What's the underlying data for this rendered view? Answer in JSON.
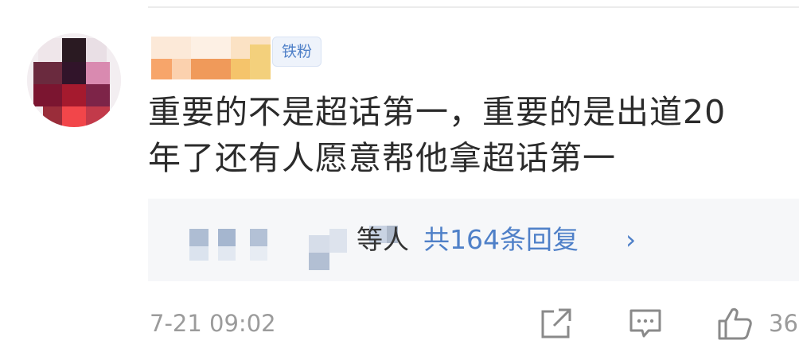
{
  "comment": {
    "badge": "铁粉",
    "text_line1": "重要的不是超话第一，重要的是出道20",
    "text_line2": "年了还有人愿意帮他拿超话第一",
    "timestamp": "7-21 09:02",
    "like_count": "36"
  },
  "replies": {
    "suffix": "等人",
    "count_label": "共164条回复",
    "chevron": "›"
  },
  "icons": {
    "share": "share-icon",
    "comment": "comment-icon",
    "like": "thumbs-up-icon"
  },
  "colors": {
    "accent": "#4f80c8",
    "text": "#2b2b2b",
    "muted": "#9b9b9b",
    "reply_bg": "#f6f7f9"
  }
}
